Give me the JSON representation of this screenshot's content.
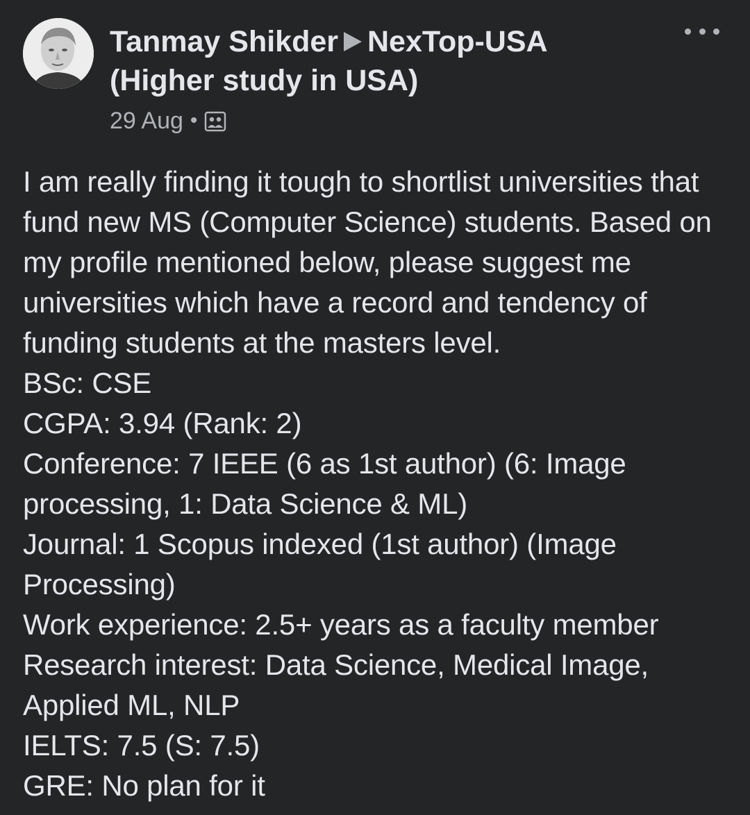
{
  "post": {
    "author": "Tanmay Shikder",
    "group": "NexTop-USA",
    "group_sub": "(Higher study in USA)",
    "date": "29 Aug",
    "separator": "•",
    "audience_icon": "group-members-icon",
    "more_icon": "more-options-icon",
    "body": "I am really finding it tough to shortlist universities that fund new MS (Computer Science) students. Based on my profile mentioned below, please suggest me universities which have a record and tendency of funding students at the masters level.\nBSc: CSE\nCGPA: 3.94 (Rank: 2)\nConference: 7 IEEE (6 as 1st author) (6: Image processing, 1: Data Science & ML)\nJournal: 1 Scopus indexed (1st author) (Image Processing)\nWork experience: 2.5+ years as a faculty member\nResearch interest: Data Science, Medical Image, Applied ML, NLP\nIELTS: 7.5 (S: 7.5)\nGRE: No plan for it"
  },
  "colors": {
    "background": "#242526",
    "primary_text": "#e4e6eb",
    "secondary_text": "#b0b3b8"
  }
}
